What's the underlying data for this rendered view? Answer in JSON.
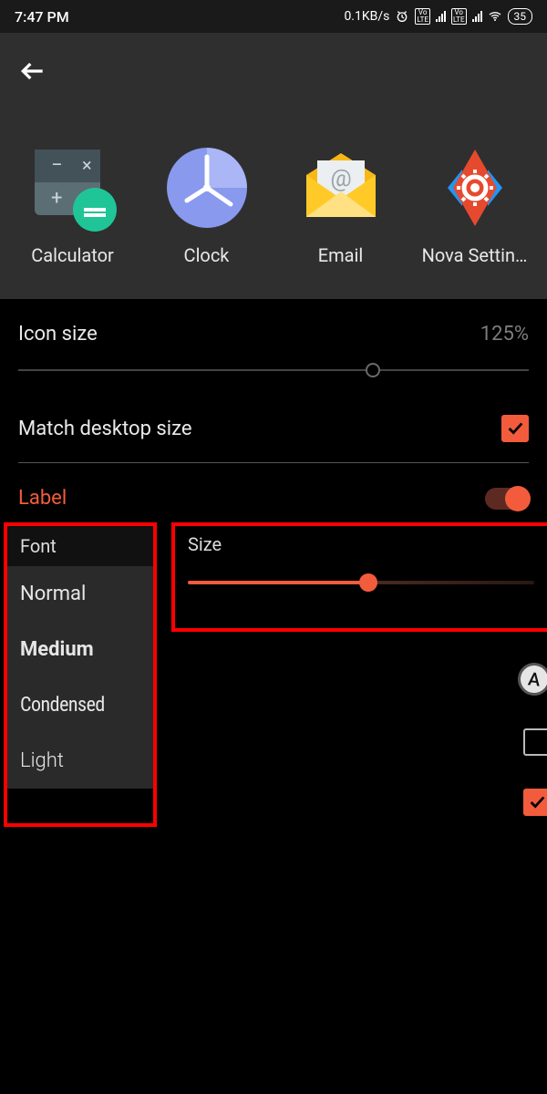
{
  "status": {
    "time": "7:47 PM",
    "net_speed": "0.1KB/s",
    "battery": "35"
  },
  "preview_apps": [
    {
      "name": "Calculator"
    },
    {
      "name": "Clock"
    },
    {
      "name": "Email"
    },
    {
      "name": "Nova Settin…"
    }
  ],
  "settings": {
    "icon_size": {
      "label": "Icon size",
      "value": "125%",
      "slider_pct": 68
    },
    "match_desktop": {
      "label": "Match desktop size",
      "checked": true
    }
  },
  "label_section": {
    "title": "Label",
    "enabled": true,
    "font": {
      "header": "Font",
      "options": [
        "Normal",
        "Medium",
        "Condensed",
        "Light"
      ]
    },
    "size": {
      "header": "Size",
      "pct": 52
    },
    "color_badge": "A",
    "row_checkbox_1": false,
    "row_checkbox_2": true
  }
}
